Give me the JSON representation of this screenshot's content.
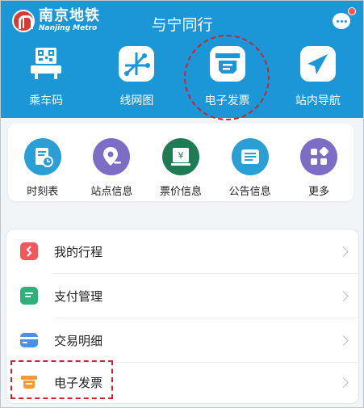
{
  "header": {
    "brand_cn": "南京地铁",
    "brand_en": "Nanjing Metro",
    "title": "与宁同行",
    "bg_color": "#1b97d8",
    "message_icon": "chat-bubble-icon",
    "has_badge": true
  },
  "top_grid": [
    {
      "label": "乘车码",
      "icon": "qr-code-icon"
    },
    {
      "label": "线网图",
      "icon": "network-map-icon"
    },
    {
      "label": "电子发票",
      "icon": "printer-invoice-icon"
    },
    {
      "label": "站内导航",
      "icon": "navigation-arrow-icon"
    }
  ],
  "second_grid": [
    {
      "label": "时刻表",
      "icon": "timetable-icon",
      "color": "#2a9fd6"
    },
    {
      "label": "站点信息",
      "icon": "station-pin-icon",
      "color": "#7d6dc4"
    },
    {
      "label": "票价信息",
      "icon": "fare-ticket-icon",
      "color": "#1e7b54"
    },
    {
      "label": "公告信息",
      "icon": "announcement-icon",
      "color": "#2a9fd6"
    },
    {
      "label": "更多",
      "icon": "more-grid-icon",
      "color": "#7d6dc4"
    }
  ],
  "list": [
    {
      "label": "我的行程",
      "icon": "trip-route-icon",
      "color": "#f2575b"
    },
    {
      "label": "支付管理",
      "icon": "payment-doc-icon",
      "color": "#2fb27a"
    },
    {
      "label": "交易明细",
      "icon": "card-icon",
      "color": "#4b8fe8"
    },
    {
      "label": "电子发票",
      "icon": "invoice-printer-icon",
      "color": "#f39a3a"
    }
  ],
  "highlight_color": "#c7262f"
}
